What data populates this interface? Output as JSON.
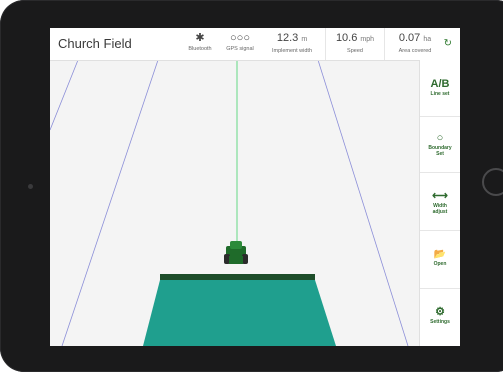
{
  "header": {
    "title": "Church Field",
    "bluetooth_label": "Bluetooth",
    "gps_label": "GPS signal",
    "gps_dots": "○○○",
    "implement_value": "12.3",
    "implement_unit": "m",
    "implement_label": "Implement width",
    "speed_value": "10.6",
    "speed_unit": "mph",
    "speed_label": "Speed",
    "area_value": "0.07",
    "area_unit": "ha",
    "area_label": "Area covered",
    "reset_label": "Reset"
  },
  "sidebar": {
    "items": [
      {
        "icon": "A/B",
        "label_1": "Line set",
        "label_2": ""
      },
      {
        "icon": "○",
        "label_1": "Boundary",
        "label_2": "Set"
      },
      {
        "icon": "⟷",
        "label_1": "Width",
        "label_2": "adjust"
      },
      {
        "icon": "📂",
        "label_1": "Open",
        "label_2": ""
      },
      {
        "icon": "⚙",
        "label_1": "Settings",
        "label_2": ""
      }
    ]
  },
  "colors": {
    "accent": "#2f7a2f",
    "covered_area": "#1f9f8e",
    "tractor": "#1f6b2a",
    "guide_line": "#40d06a",
    "field_lines": "#8c8fd8"
  }
}
